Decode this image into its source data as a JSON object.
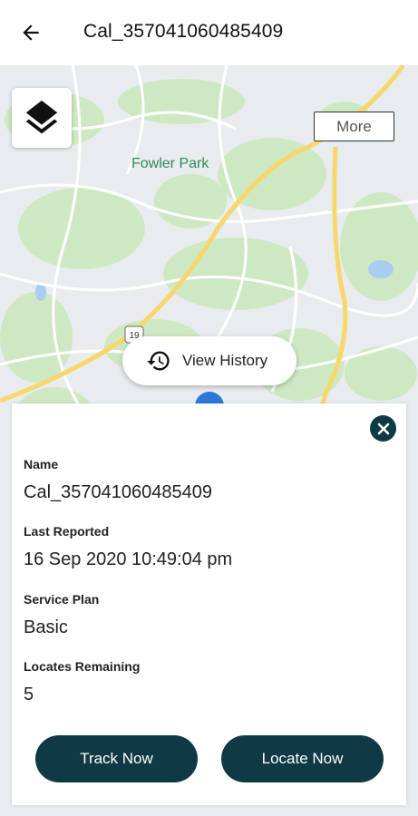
{
  "header": {
    "title": "Cal_357041060485409"
  },
  "map": {
    "park_label": "Fowler Park",
    "more_label": "More",
    "view_history_label": "View History",
    "route_label": "19"
  },
  "details": {
    "name_label": "Name",
    "name_value": "Cal_357041060485409",
    "last_reported_label": "Last Reported",
    "last_reported_value": "16 Sep 2020 10:49:04 pm",
    "service_plan_label": "Service Plan",
    "service_plan_value": "Basic",
    "locates_remaining_label": "Locates Remaining",
    "locates_remaining_value": "5"
  },
  "actions": {
    "track_label": "Track Now",
    "locate_label": "Locate Now"
  },
  "colors": {
    "primary": "#0f3944",
    "marker": "#2979d9",
    "park": "#2f8a57"
  }
}
